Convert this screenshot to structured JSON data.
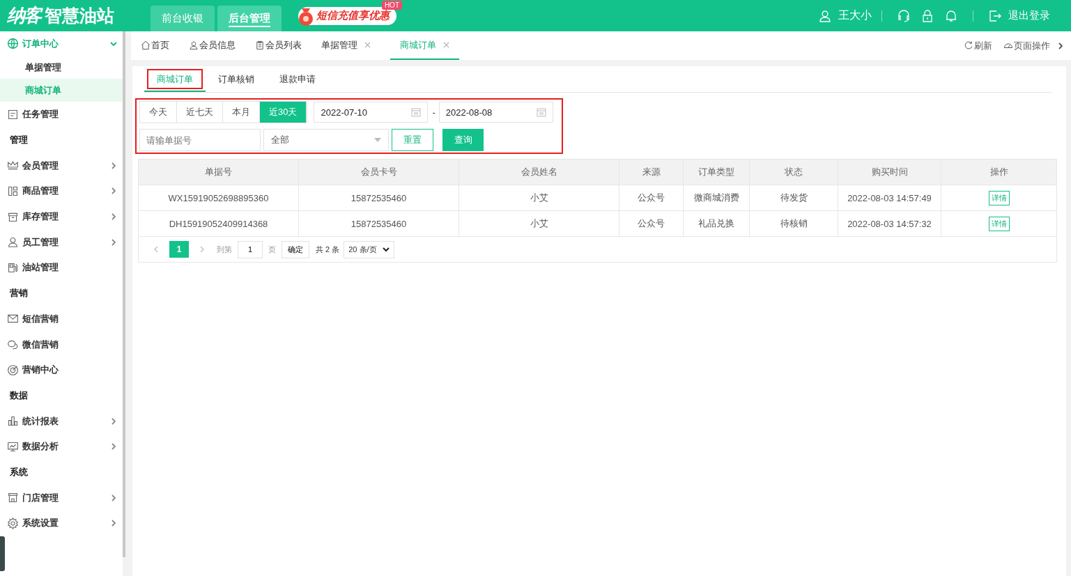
{
  "header": {
    "logo_mark": "纳客",
    "logo_text": "智慧油站",
    "nav_tabs": [
      {
        "label": "前台收银",
        "selected": false
      },
      {
        "label": "后台管理",
        "selected": true
      }
    ],
    "promo": {
      "text": "短信充值享优惠",
      "badge": "HOT"
    },
    "user": "王大小",
    "logout": "退出登录"
  },
  "sidebar": [
    {
      "kind": "group",
      "label": "订单中心",
      "expanded": true,
      "children": [
        {
          "label": "单据管理",
          "selected": false
        },
        {
          "label": "商城订单",
          "selected": true
        }
      ]
    },
    {
      "kind": "item",
      "label": "任务管理",
      "has_submenu": false
    },
    {
      "kind": "heading",
      "label": "管理"
    },
    {
      "kind": "item",
      "label": "会员管理",
      "has_submenu": true
    },
    {
      "kind": "item",
      "label": "商品管理",
      "has_submenu": true
    },
    {
      "kind": "item",
      "label": "库存管理",
      "has_submenu": true
    },
    {
      "kind": "item",
      "label": "员工管理",
      "has_submenu": true
    },
    {
      "kind": "item",
      "label": "油站管理",
      "has_submenu": false
    },
    {
      "kind": "heading",
      "label": "营销"
    },
    {
      "kind": "item",
      "label": "短信营销",
      "has_submenu": false
    },
    {
      "kind": "item",
      "label": "微信营销",
      "has_submenu": false
    },
    {
      "kind": "item",
      "label": "营销中心",
      "has_submenu": false
    },
    {
      "kind": "heading",
      "label": "数据"
    },
    {
      "kind": "item",
      "label": "统计报表",
      "has_submenu": true
    },
    {
      "kind": "item",
      "label": "数据分析",
      "has_submenu": true
    },
    {
      "kind": "heading",
      "label": "系统"
    },
    {
      "kind": "item",
      "label": "门店管理",
      "has_submenu": true
    },
    {
      "kind": "item",
      "label": "系统设置",
      "has_submenu": true
    }
  ],
  "page_tabs": [
    {
      "label": "首页",
      "closable": false,
      "selected": false
    },
    {
      "label": "会员信息",
      "closable": false,
      "selected": false
    },
    {
      "label": "会员列表",
      "closable": false,
      "selected": false
    },
    {
      "label": "单据管理",
      "closable": true,
      "selected": false
    },
    {
      "label": "商城订单",
      "closable": true,
      "selected": true
    }
  ],
  "page_actions": {
    "refresh": "刷新",
    "page_ops": "页面操作"
  },
  "sub_tabs": [
    {
      "label": "商城订单",
      "selected": true,
      "highlighted": true
    },
    {
      "label": "订单核销",
      "selected": false,
      "highlighted": false
    },
    {
      "label": "退款申请",
      "selected": false,
      "highlighted": false
    }
  ],
  "filter": {
    "highlighted": true,
    "ranges": [
      {
        "label": "今天",
        "selected": false
      },
      {
        "label": "近七天",
        "selected": false
      },
      {
        "label": "本月",
        "selected": false
      },
      {
        "label": "近30天",
        "selected": true
      }
    ],
    "date_from": "2022-07-10",
    "date_sep": "-",
    "date_to": "2022-08-08",
    "order_no": {
      "placeholder": "请输单据号"
    },
    "status": "全部",
    "reset": "重置",
    "query": "查询"
  },
  "table": {
    "columns": [
      "单据号",
      "会员卡号",
      "会员姓名",
      "来源",
      "订单类型",
      "状态",
      "购买时间",
      "操作"
    ],
    "rows": [
      {
        "cells": [
          "WX15919052698895360",
          "15872535460",
          "小艾",
          "公众号",
          "微商城消费",
          "待发货",
          "2022-08-03 14:57:49"
        ],
        "action": "详情"
      },
      {
        "cells": [
          "DH15919052409914368",
          "15872535460",
          "小艾",
          "公众号",
          "礼品兑换",
          "待核销",
          "2022-08-03 14:57:32"
        ],
        "action": "详情"
      }
    ]
  },
  "pagination": {
    "pages": [
      {
        "label": "1",
        "selected": true
      }
    ],
    "goto_label": "到第",
    "goto_value": "1",
    "page_unit": "页",
    "confirm": "确定",
    "total": "共 2 条",
    "page_size": "20 条/页"
  }
}
